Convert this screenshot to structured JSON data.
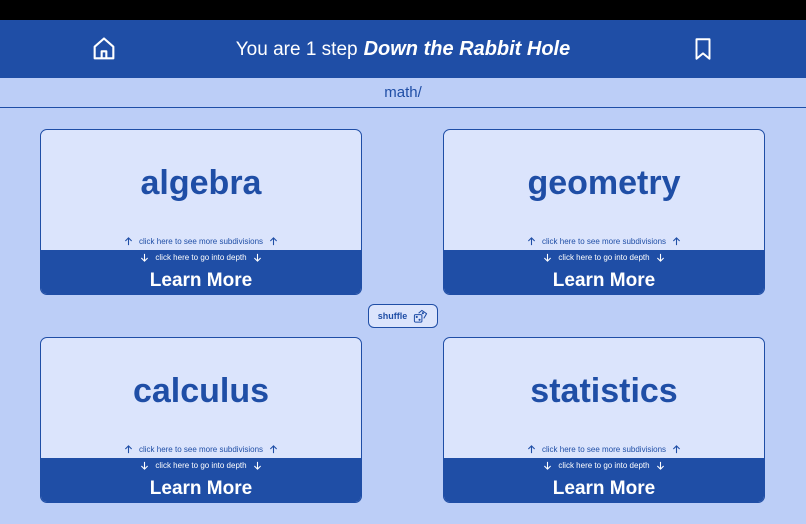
{
  "header": {
    "step_text": "You are 1 step",
    "brand": "Down the Rabbit Hole",
    "home_icon": "home-icon",
    "bookmark_icon": "bookmark-icon"
  },
  "path": "math/",
  "cards": [
    {
      "title": "algebra",
      "subdivisions": "click here to see more subdivisions",
      "depth": "click here to go into depth",
      "learn": "Learn More"
    },
    {
      "title": "geometry",
      "subdivisions": "click here to see more subdivisions",
      "depth": "click here to go into depth",
      "learn": "Learn More"
    },
    {
      "title": "calculus",
      "subdivisions": "click here to see more subdivisions",
      "depth": "click here to go into depth",
      "learn": "Learn More"
    },
    {
      "title": "statistics",
      "subdivisions": "click here to see more subdivisions",
      "depth": "click here to go into depth",
      "learn": "Learn More"
    }
  ],
  "shuffle": {
    "label": "shuffle",
    "icon": "shuffle-dice-icon"
  },
  "colors": {
    "primary": "#1f4ea6",
    "background": "#bccef7",
    "card": "#dbe4fc"
  }
}
